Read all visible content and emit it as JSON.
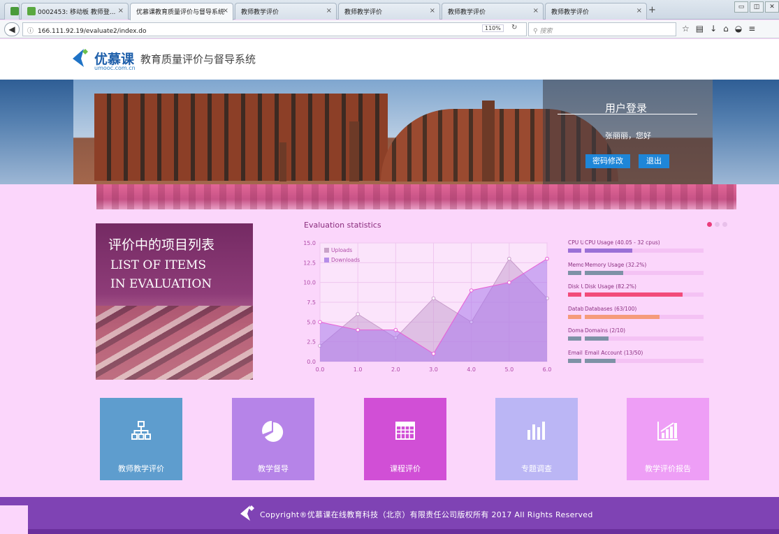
{
  "browser": {
    "tabs": [
      {
        "label": "0002453: 移动板 教师登..."
      },
      {
        "label": "优慕课教育质量评价与督导系统"
      },
      {
        "label": "教师教学评价"
      },
      {
        "label": "教师教学评价"
      },
      {
        "label": "教师教学评价"
      },
      {
        "label": "教师教学评价"
      },
      {
        "label": "教师教学评价"
      }
    ],
    "url": "166.111.92.19/evaluate2/index.do",
    "zoom": "110%",
    "search_placeholder": "搜索"
  },
  "header": {
    "logo_text": "优慕课",
    "logo_sub": "umooc.com.cn",
    "system_name": "教育质量评价与督导系统"
  },
  "login": {
    "title": "用户登录",
    "greeting": "张丽丽，您好",
    "change_password": "密码修改",
    "logout": "退出"
  },
  "list_card": {
    "title_cn": "评价中的项目列表",
    "title_en_1": "LIST OF ITEMS",
    "title_en_2": "IN EVALUATION"
  },
  "chart_title": "Evaluation statistics",
  "chart_data": {
    "type": "area",
    "title": "Evaluation statistics",
    "x": [
      0.0,
      1.0,
      2.0,
      3.0,
      4.0,
      5.0,
      6.0
    ],
    "x_tick_labels": [
      "0.0",
      "1.0",
      "2.0",
      "3.0",
      "4.0",
      "5.0",
      "6.0"
    ],
    "y_tick_labels": [
      "0.0",
      "2.5",
      "5.0",
      "7.5",
      "10.0",
      "12.5",
      "15.0"
    ],
    "ylim": [
      0,
      15
    ],
    "xlim": [
      0,
      6
    ],
    "grid": true,
    "legend": "top-left",
    "series": [
      {
        "name": "Uploads",
        "color": "#c9a3c9",
        "values": [
          2,
          6,
          3,
          8,
          5,
          13,
          8
        ]
      },
      {
        "name": "Downloads",
        "color": "#b58ee8",
        "values": [
          5,
          4,
          4,
          1,
          9,
          10,
          13
        ]
      }
    ]
  },
  "usage": [
    {
      "short": "CPU U",
      "label": "CPU Usage (40.05 - 32 cpus)",
      "value": 0.4,
      "color": "#9b70d6"
    },
    {
      "short": "Memo",
      "label": "Memory Usage (32.2%)",
      "value": 0.322,
      "color": "#7e92a6"
    },
    {
      "short": "Disk U",
      "label": "Disk Usage (82.2%)",
      "value": 0.822,
      "color": "#f24b7a"
    },
    {
      "short": "Datab",
      "label": "Databases (63/100)",
      "value": 0.63,
      "color": "#f59b7b"
    },
    {
      "short": "Doma",
      "label": "Domains (2/10)",
      "value": 0.2,
      "color": "#7e92a6"
    },
    {
      "short": "Email",
      "label": "Email Account (13/50)",
      "value": 0.26,
      "color": "#7e92a6"
    }
  ],
  "modules": [
    {
      "label": "教师教学评价",
      "icon": "sitemap-icon",
      "color": "#5e9dce"
    },
    {
      "label": "教学督导",
      "icon": "pie-chart-icon",
      "color": "#b684e8"
    },
    {
      "label": "课程评价",
      "icon": "calendar-icon",
      "color": "#d14fd6"
    },
    {
      "label": "专题调查",
      "icon": "bar-chart-icon",
      "color": "#bbb6f5"
    },
    {
      "label": "教学评价报告",
      "icon": "growth-chart-icon",
      "color": "#ee9ef6"
    }
  ],
  "footer": {
    "copyright": "Copyright®优慕课在线教育科技（北京）有限责任公司版权所有 2017 All Rights Reserved"
  }
}
